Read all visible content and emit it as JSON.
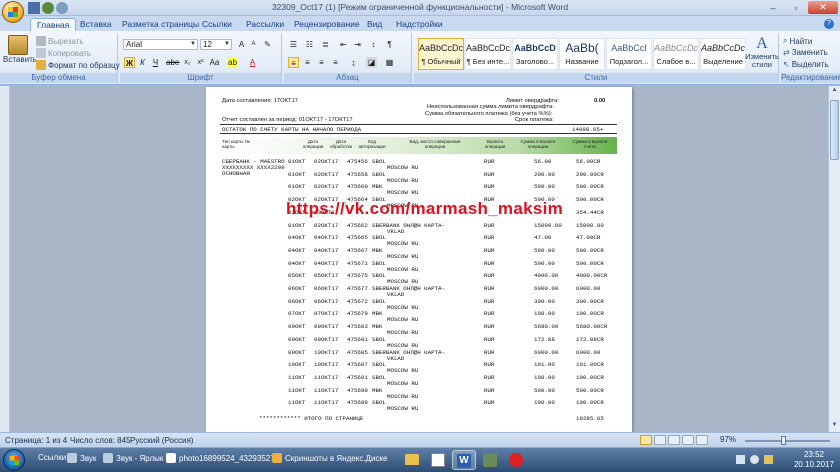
{
  "window": {
    "title": "32309_Oct17 (1) [Режим ограниченной функциональности] - Microsoft Word",
    "controls": [
      "–",
      "▫",
      "✕"
    ]
  },
  "tabs": [
    "Главная",
    "Вставка",
    "Разметка страницы",
    "Ссылки",
    "Рассылки",
    "Рецензирование",
    "Вид",
    "Надстройки"
  ],
  "ribbon": {
    "clipboard": {
      "paste": "Вставить",
      "cut": "Вырезать",
      "copy": "Копировать",
      "format_painter": "Формат по образцу",
      "label": "Буфер обмена"
    },
    "font": {
      "name": "Arial",
      "size": "12",
      "label": "Шрифт"
    },
    "paragraph": {
      "label": "Абзац"
    },
    "styles": {
      "label": "Стили",
      "items": [
        {
          "sample": "AaBbCcDc",
          "name": "¶ Обычный"
        },
        {
          "sample": "AaBbCcDc",
          "name": "¶ Без инте..."
        },
        {
          "sample": "AaBbCcD",
          "name": "Заголово..."
        },
        {
          "sample": "AaBb(",
          "name": "Название"
        },
        {
          "sample": "AaBbCcI",
          "name": "Подзагол..."
        },
        {
          "sample": "AaBbCcDc",
          "name": "Слабое в..."
        },
        {
          "sample": "AaBbCcDc",
          "name": "Выделение"
        }
      ],
      "change": "Изменить стили"
    },
    "editing": {
      "find": "Найти",
      "replace": "Заменить",
      "select": "Выделить",
      "label": "Редактирование"
    }
  },
  "document": {
    "date_line": "Дата составления: 17ОКТ17",
    "overdraft": "Лимит овердрафта:",
    "overdraft_value": "0.00",
    "unused_overdraft": "Неиспользованная сумма лимита овердрафта:",
    "min_payment": "Сумма обязательного платежа (без учета %%):",
    "due_date": "Срок платежа:",
    "period": "Отчет составлен за период: 01ОКТ17 - 17ОКТ17",
    "opening_balance_label": "ОСТАТОК ПО СЧЕТУ КАРТЫ НА НАЧАЛО ПЕРИОДА",
    "opening_balance": "14098.65+",
    "headers": [
      "Тип карты № карты",
      "Дата операции",
      "Дата обработки",
      "Код авторизации",
      "Вид, место совершения операции",
      "Валюта операции",
      "Сумма в валюте операции",
      "Сумма в валюте счета"
    ],
    "card": [
      "СБЕРБАНК - MAESTRO",
      "XXXXXXXXX XXXX2209",
      "ОСНОВНАЯ"
    ],
    "rows": [
      {
        "d1": "01ОКТ",
        "d2": "02ОКТ17",
        "code": "475456",
        "desc": "SBOL",
        "sub": "MOSCOW RU",
        "cur": "RUR",
        "amt": "56.00",
        "acc": "56.00CR"
      },
      {
        "d1": "01ОКТ",
        "d2": "02ОКТ17",
        "code": "475658",
        "desc": "SBOL",
        "sub": "MOSCOW RU",
        "cur": "RUR",
        "amt": "200.00",
        "acc": "200.00CR"
      },
      {
        "d1": "01ОКТ",
        "d2": "02ОКТ17",
        "code": "475660",
        "desc": "MBK",
        "sub": "MOSCOW RU",
        "cur": "RUR",
        "amt": "500.00",
        "acc": "500.00CR"
      },
      {
        "d1": "02ОКТ",
        "d2": "02ОКТ17",
        "code": "475664",
        "desc": "SBOL",
        "sub": "MOSCOW RU",
        "cur": "RUR",
        "amt": "500.00",
        "acc": "500.00CR"
      },
      {
        "d1": "02ОКТ",
        "d2": "03ОКТ17",
        "code": "",
        "desc": "",
        "sub": "",
        "cur": "",
        "amt": "",
        "acc": "354.44CR"
      },
      {
        "d1": "01ОКТ",
        "d2": "02ОКТ17",
        "code": "475662",
        "desc": "SBERBANK ОНЛ@Н КАРТА-",
        "sub": "VKLAD",
        "cur": "RUR",
        "amt": "15000.00",
        "acc": "15000.00"
      },
      {
        "d1": "04ОКТ",
        "d2": "04ОКТ17",
        "code": "475665",
        "desc": "SBOL",
        "sub": "MOSCOW RU",
        "cur": "RUR",
        "amt": "47.00",
        "acc": "47.00CR"
      },
      {
        "d1": "04ОКТ",
        "d2": "04ОКТ17",
        "code": "475667",
        "desc": "MBK",
        "sub": "MOSCOW RU",
        "cur": "RUR",
        "amt": "500.00",
        "acc": "500.00CR"
      },
      {
        "d1": "04ОКТ",
        "d2": "04ОКТ17",
        "code": "475671",
        "desc": "SBOL",
        "sub": "MOSCOW RU",
        "cur": "RUR",
        "amt": "500.00",
        "acc": "500.00CR"
      },
      {
        "d1": "05ОКТ",
        "d2": "05ОКТ17",
        "code": "475675",
        "desc": "SBOL",
        "sub": "MOSCOW RU",
        "cur": "RUR",
        "amt": "4000.00",
        "acc": "4000.00CR"
      },
      {
        "d1": "06ОКТ",
        "d2": "06ОКТ17",
        "code": "475677",
        "desc": "SBERBANK ОНЛ@Н КАРТА-",
        "sub": "VKLAD",
        "cur": "RUR",
        "amt": "6000.00",
        "acc": "6000.00"
      },
      {
        "d1": "06ОКТ",
        "d2": "06ОКТ17",
        "code": "475672",
        "desc": "SBOL",
        "sub": "MOSCOW RU",
        "cur": "RUR",
        "amt": "300.00",
        "acc": "300.00CR"
      },
      {
        "d1": "07ОКТ",
        "d2": "07ОКТ17",
        "code": "475679",
        "desc": "MBK",
        "sub": "MOSCOW RU",
        "cur": "RUR",
        "amt": "100.00",
        "acc": "100.00CR"
      },
      {
        "d1": "09ОКТ",
        "d2": "09ОКТ17",
        "code": "475683",
        "desc": "MBK",
        "sub": "MOSCOW RU",
        "cur": "RUR",
        "amt": "5680.00",
        "acc": "5680.00CR"
      },
      {
        "d1": "09ОКТ",
        "d2": "09ОКТ17",
        "code": "475681",
        "desc": "SBOL",
        "sub": "MOSCOW RU",
        "cur": "RUR",
        "amt": "172.88",
        "acc": "172.88CR"
      },
      {
        "d1": "09ОКТ",
        "d2": "10ОКТ17",
        "code": "475685",
        "desc": "SBERBANK ОНЛ@Н КАРТА-",
        "sub": "VKLAD",
        "cur": "RUR",
        "amt": "6000.00",
        "acc": "6000.00"
      },
      {
        "d1": "10ОКТ",
        "d2": "10ОКТ17",
        "code": "475687",
        "desc": "SBOL",
        "sub": "MOSCOW RU",
        "cur": "RUR",
        "amt": "101.00",
        "acc": "101.00CR"
      },
      {
        "d1": "11ОКТ",
        "d2": "11ОКТ17",
        "code": "475691",
        "desc": "SBOL",
        "sub": "MOSCOW RU",
        "cur": "RUR",
        "amt": "100.00",
        "acc": "100.00CR"
      },
      {
        "d1": "11ОКТ",
        "d2": "11ОКТ17",
        "code": "475690",
        "desc": "MBK",
        "sub": "MOSCOW RU",
        "cur": "RUR",
        "amt": "500.00",
        "acc": "500.00CR"
      },
      {
        "d1": "11ОКТ",
        "d2": "11ОКТ17",
        "code": "475689",
        "desc": "SBOL",
        "sub": "MOSCOW RU",
        "cur": "RUR",
        "amt": "100.00",
        "acc": "100.00CR"
      }
    ],
    "total_label": "************ ИТОГО ПО СТРАНИЦЕ",
    "total_value": "19285.65",
    "watermark": "https://vk.com/marmash_maksim"
  },
  "status": {
    "page": "Страница: 1 из 4",
    "words": "Число слов: 845",
    "language": "Русский (Россия)",
    "zoom": "97%"
  },
  "taskbar": {
    "links": "Ссылки",
    "items": [
      "Звук",
      "Звук - Ярлык",
      "photo16899524_432935275",
      "Скриншоты в Яндекс.Диске"
    ],
    "time": "23:52",
    "date": "20.10.2017"
  }
}
